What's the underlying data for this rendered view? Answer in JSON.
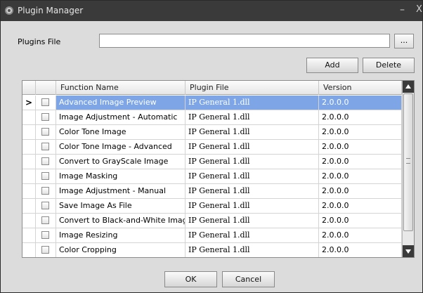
{
  "window": {
    "title": "Plugin Manager",
    "minimize_glyph": "–",
    "close_glyph": "X",
    "app_icon": "app-icon"
  },
  "plugins_file": {
    "label": "Plugins File",
    "value": "",
    "browse_label": "..."
  },
  "actions": {
    "add_label": "Add",
    "delete_label": "Delete"
  },
  "grid": {
    "columns": [
      "Function Name",
      "Plugin File",
      "Version"
    ],
    "selected_row_indicator": ">",
    "selected_color": "#7ea6e6",
    "rows": [
      {
        "function": "Advanced Image Preview",
        "file": "IP General 1.dll",
        "version": "2.0.0.0",
        "checked": false,
        "selected": true
      },
      {
        "function": "Image Adjustment - Automatic",
        "file": "IP General 1.dll",
        "version": "2.0.0.0",
        "checked": false,
        "selected": false
      },
      {
        "function": "Color Tone Image",
        "file": "IP General 1.dll",
        "version": "2.0.0.0",
        "checked": false,
        "selected": false
      },
      {
        "function": "Color Tone Image - Advanced",
        "file": "IP General 1.dll",
        "version": "2.0.0.0",
        "checked": false,
        "selected": false
      },
      {
        "function": "Convert to GrayScale Image",
        "file": "IP General 1.dll",
        "version": "2.0.0.0",
        "checked": false,
        "selected": false
      },
      {
        "function": "Image Masking",
        "file": "IP General 1.dll",
        "version": "2.0.0.0",
        "checked": false,
        "selected": false
      },
      {
        "function": "Image Adjustment - Manual",
        "file": "IP General 1.dll",
        "version": "2.0.0.0",
        "checked": false,
        "selected": false
      },
      {
        "function": "Save Image As File",
        "file": "IP General 1.dll",
        "version": "2.0.0.0",
        "checked": false,
        "selected": false
      },
      {
        "function": "Convert to Black-and-White Image",
        "file": "IP General 1.dll",
        "version": "2.0.0.0",
        "checked": false,
        "selected": false
      },
      {
        "function": "Image Resizing",
        "file": "IP General 1.dll",
        "version": "2.0.0.0",
        "checked": false,
        "selected": false
      },
      {
        "function": "Color Cropping",
        "file": "IP General 1.dll",
        "version": "2.0.0.0",
        "checked": false,
        "selected": false
      }
    ]
  },
  "footer": {
    "ok_label": "OK",
    "cancel_label": "Cancel"
  }
}
